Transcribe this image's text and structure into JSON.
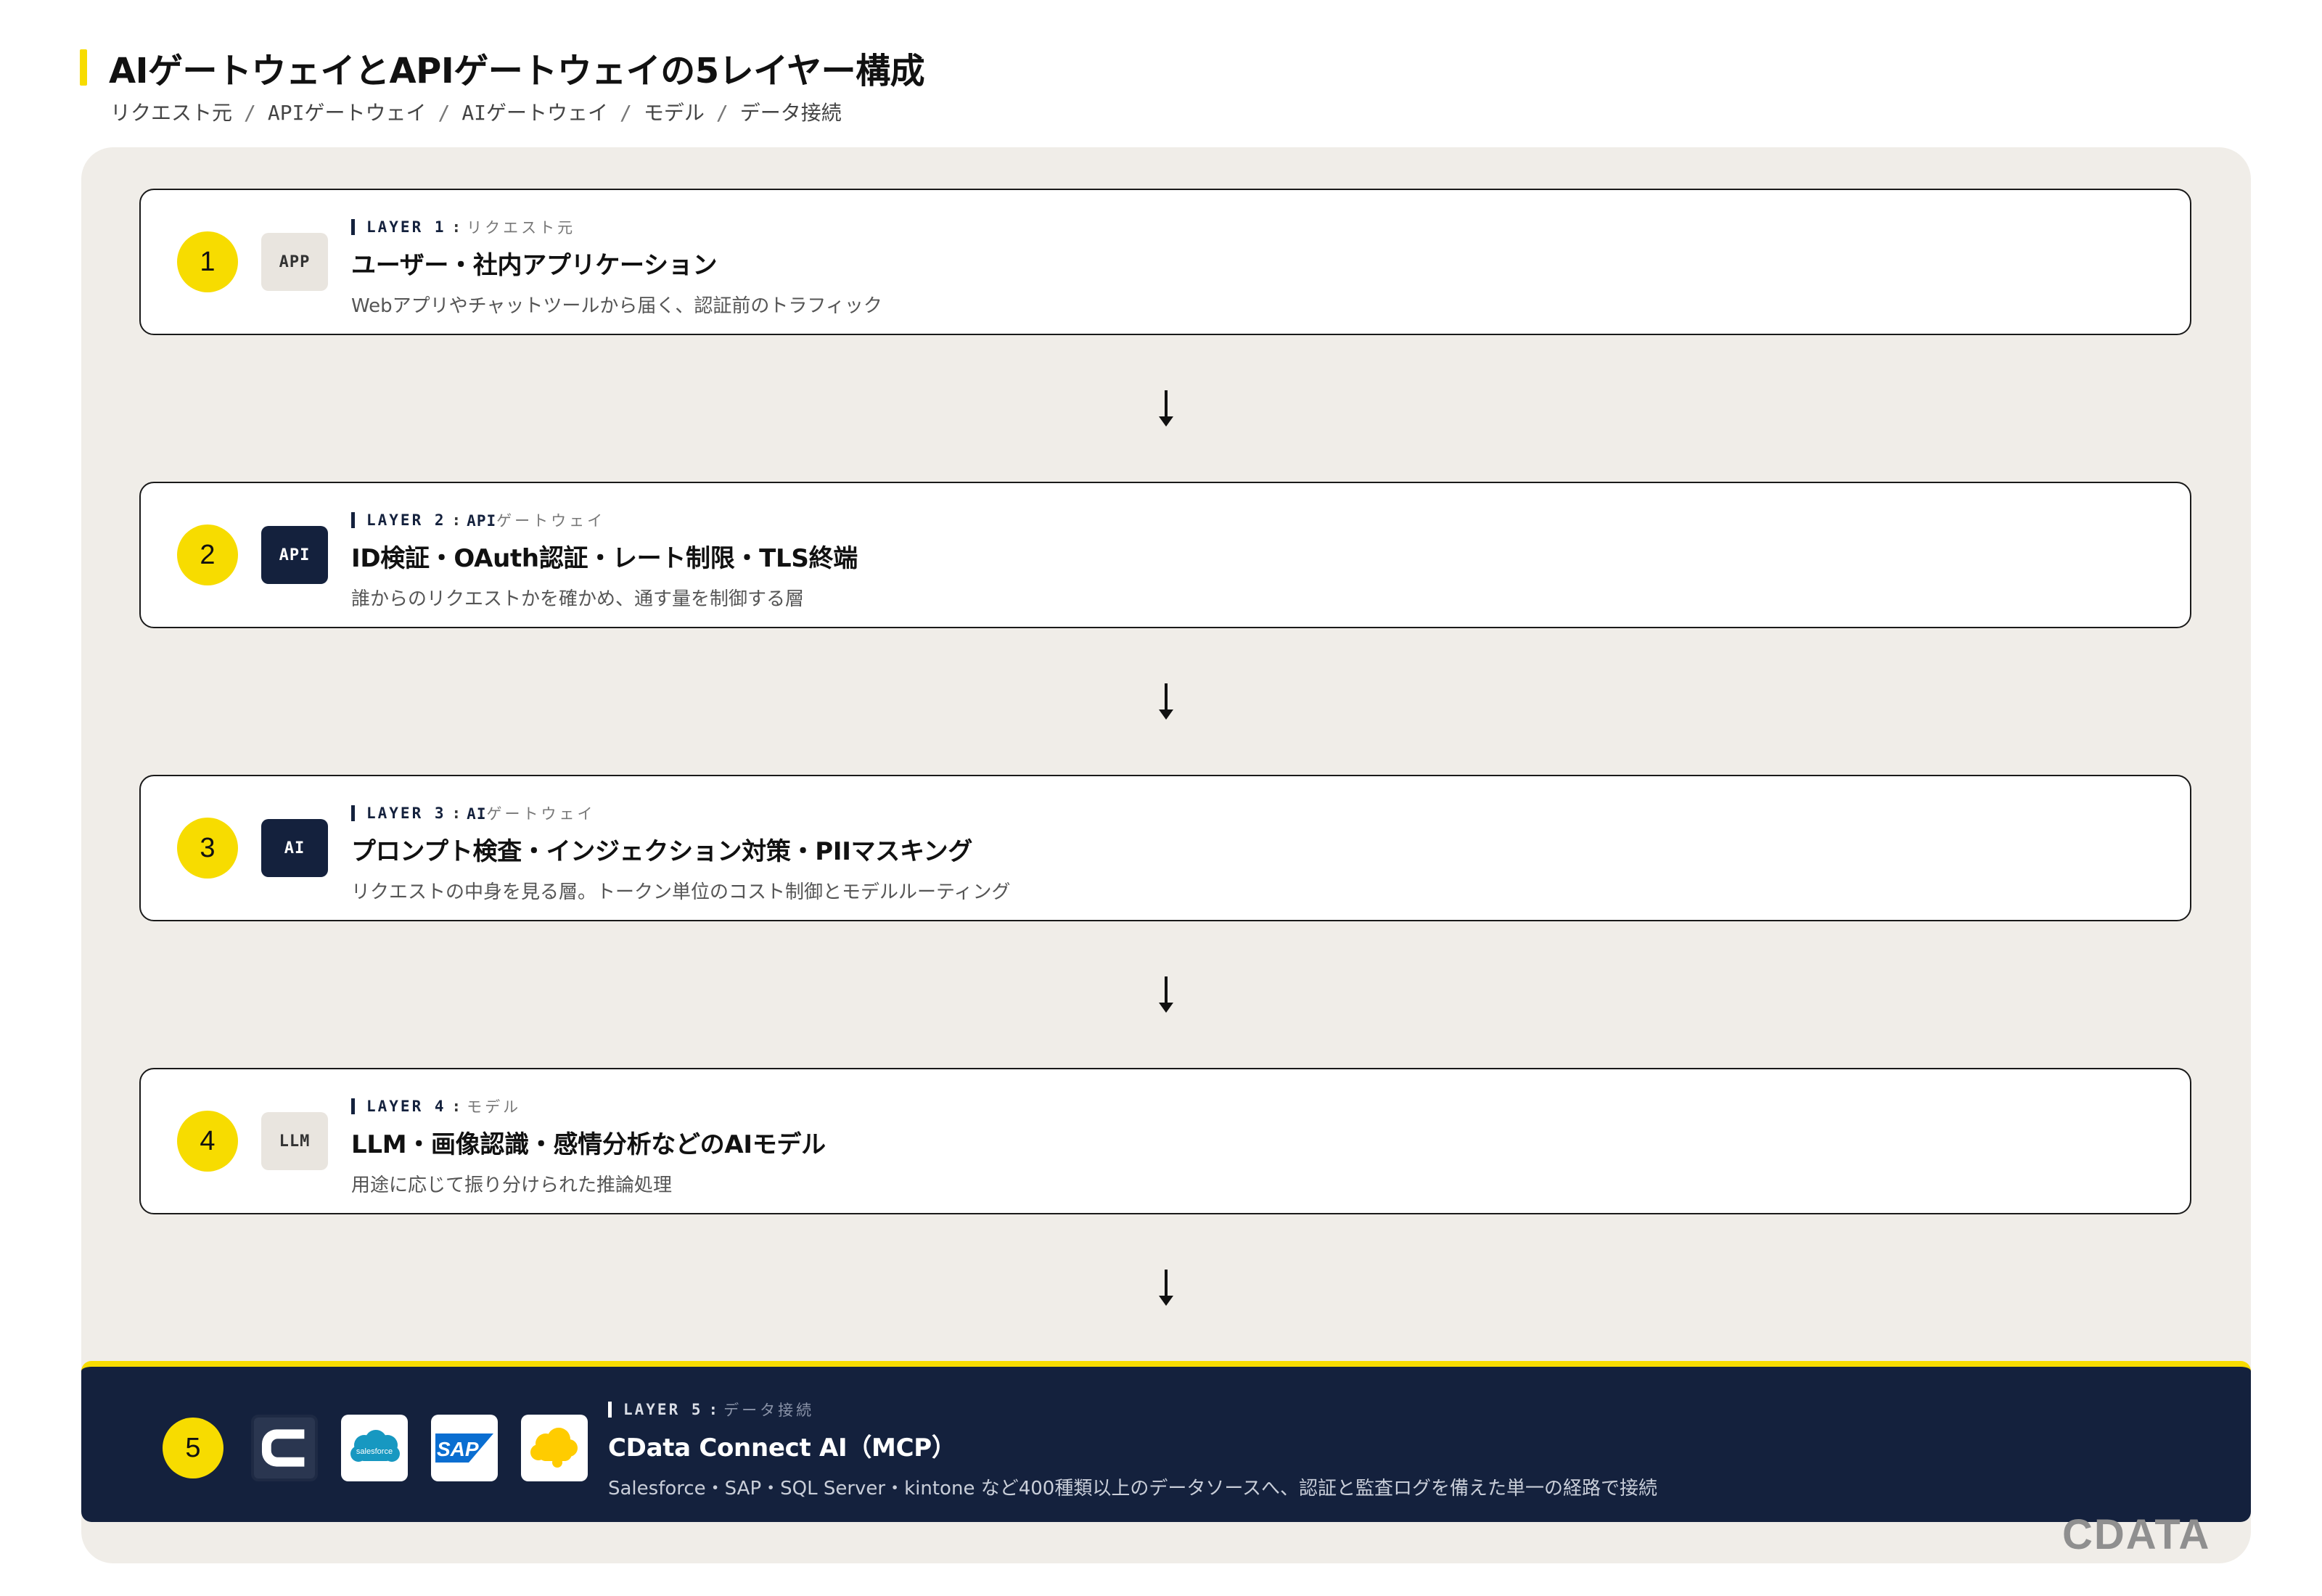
{
  "page": {
    "title": "AIゲートウェイとAPIゲートウェイの5レイヤー構成",
    "breadcrumb": [
      "リクエスト元",
      "APIゲートウェイ",
      "AIゲートウェイ",
      "モデル",
      "データ接続"
    ],
    "breadcrumb_separator": "/"
  },
  "layers": [
    {
      "number": "1",
      "badge": "APP",
      "badge_style": "light",
      "label": "LAYER 1",
      "colon": ":",
      "name_strong": "",
      "name": "リクエスト元",
      "title": "ユーザー・社内アプリケーション",
      "description": "Webアプリやチャットツールから届く、認証前のトラフィック"
    },
    {
      "number": "2",
      "badge": "API",
      "badge_style": "dark",
      "label": "LAYER 2",
      "colon": ":",
      "name_strong": "API",
      "name": "ゲートウェイ",
      "title": "ID検証・OAuth認証・レート制限・TLS終端",
      "description": "誰からのリクエストかを確かめ、通す量を制御する層"
    },
    {
      "number": "3",
      "badge": "AI",
      "badge_style": "dark",
      "label": "LAYER 3",
      "colon": ":",
      "name_strong": "AI",
      "name": "ゲートウェイ",
      "title": "プロンプト検査・インジェクション対策・PIIマスキング",
      "description": "リクエストの中身を見る層。トークン単位のコスト制御とモデルルーティング"
    },
    {
      "number": "4",
      "badge": "LLM",
      "badge_style": "light",
      "label": "LAYER 4",
      "colon": ":",
      "name_strong": "",
      "name": "モデル",
      "title": "LLM・画像認識・感情分析などのAIモデル",
      "description": "用途に応じて振り分けられた推論処理"
    }
  ],
  "layer5": {
    "number": "5",
    "label": "LAYER 5",
    "colon": ":",
    "name": "データ接続",
    "title": "CData Connect AI（MCP）",
    "description": "Salesforce・SAP・SQL Server・kintone など400種類以上のデータソースへ、認証と監査ログを備えた単一の経路で接続",
    "logos": [
      {
        "icon": "cdata-logo-icon"
      },
      {
        "icon": "salesforce-logo-icon",
        "text": "salesforce"
      },
      {
        "icon": "sap-logo-icon",
        "text": "SAP"
      },
      {
        "icon": "kintone-logo-icon"
      }
    ]
  },
  "brand": "CDATA",
  "colors": {
    "accent_yellow": "#f7dc00",
    "navy": "#14213d",
    "panel_bg": "#f0ede8",
    "badge_light": "#e9e5df",
    "salesforce_blue": "#1798c1",
    "sap_blue": "#0a6ed1",
    "kintone_yellow": "#ffcc00"
  }
}
